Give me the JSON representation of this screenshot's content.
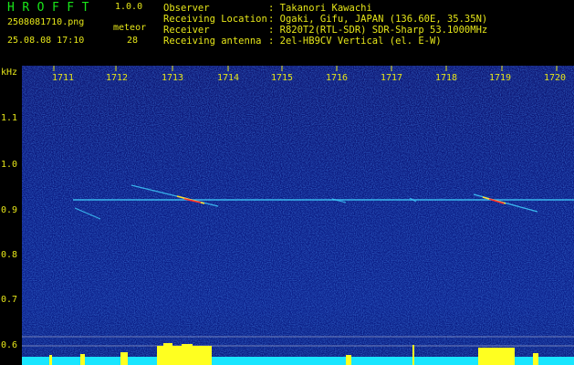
{
  "header": {
    "app_name": "HROFFT",
    "app_version": "1.0.0",
    "file_name": "2508081710.png",
    "meteor_label": "meteor",
    "date_time": "25.08.08 17:10",
    "meteor_count": "28"
  },
  "info": [
    {
      "key": "Observer",
      "value": ": Takanori Kawachi"
    },
    {
      "key": "Receiving Location",
      "value": ": Ogaki, Gifu, JAPAN (136.60E, 35.35N)"
    },
    {
      "key": "Receiver",
      "value": ": R820T2(RTL-SDR) SDR-Sharp 53.1000MHz"
    },
    {
      "key": "Receiving antenna",
      "value": ": 2el-HB9CV Vertical (el. E-W)"
    }
  ],
  "axis": {
    "unit": "kHz",
    "time_ticks": [
      "1711",
      "1712",
      "1713",
      "1714",
      "1715",
      "1716",
      "1717",
      "1718",
      "1719",
      "1720"
    ],
    "freq_ticks": [
      "1.1",
      "1.0",
      "0.9",
      "0.8",
      "0.7",
      "0.6"
    ]
  },
  "colors": {
    "background": "#000000",
    "text": "#e6e619",
    "title": "#19e619",
    "waterfall": "#0b1a82",
    "carrier": "#40d0ff",
    "meteor_head": "#ff3030",
    "level_bar": "#19e6ff",
    "level_peak": "#ffff20"
  }
}
